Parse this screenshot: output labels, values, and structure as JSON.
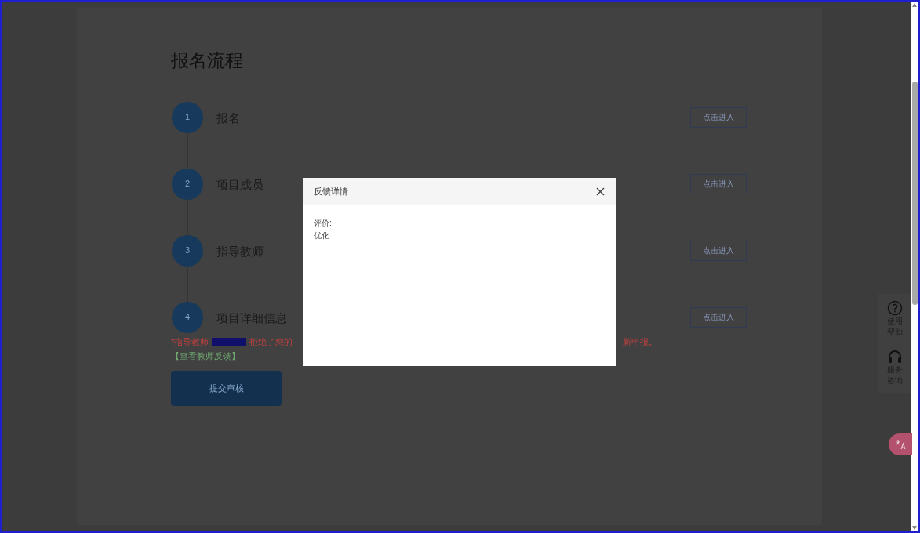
{
  "page": {
    "title": "报名流程"
  },
  "steps": [
    {
      "number": "1",
      "label": "报名",
      "button": "点击进入"
    },
    {
      "number": "2",
      "label": "项目成员",
      "button": "点击进入"
    },
    {
      "number": "3",
      "label": "指导教师",
      "button": "点击进入"
    },
    {
      "number": "4",
      "label": "项目详细信息",
      "button": "点击进入"
    }
  ],
  "notice": {
    "prefix": "*指导教师",
    "visible_start": "拒绝了您的",
    "visible_end": "新申报。",
    "link": "【查看教师反馈】"
  },
  "submit_button": "提交审核",
  "side_tools": [
    {
      "kind": "help",
      "label": "使用帮助"
    },
    {
      "kind": "service",
      "label": "服务咨询"
    }
  ],
  "modal": {
    "title": "反馈详情",
    "lines": [
      "评价:",
      "优化"
    ]
  }
}
